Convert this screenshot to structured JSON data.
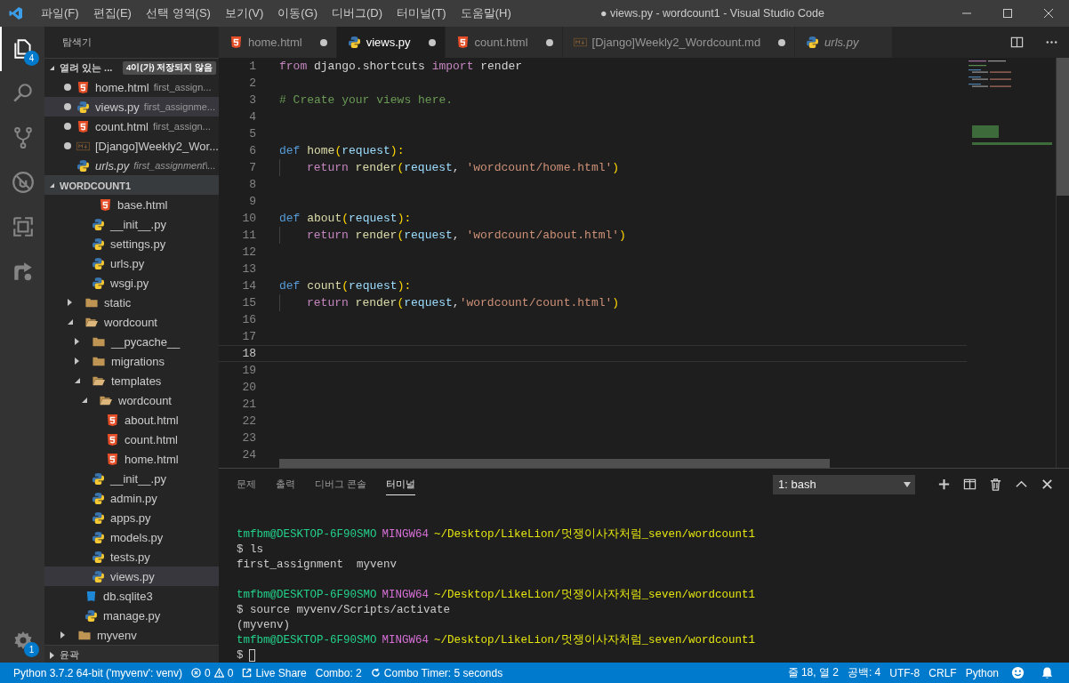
{
  "window": {
    "title": "● views.py - wordcount1 - Visual Studio Code"
  },
  "menu": [
    "파일(F)",
    "편집(E)",
    "선택 영역(S)",
    "보기(V)",
    "이동(G)",
    "디버그(D)",
    "터미널(T)",
    "도움말(H)"
  ],
  "activity_bar": [
    {
      "kind": "files",
      "selected": true,
      "badge": "4"
    },
    {
      "kind": "search",
      "selected": false
    },
    {
      "kind": "git",
      "selected": false
    },
    {
      "kind": "debug",
      "selected": false
    },
    {
      "kind": "extensions",
      "selected": false
    },
    {
      "kind": "liveshare",
      "selected": false
    }
  ],
  "manage": {
    "badge": "1"
  },
  "explorer": {
    "title": "탐색기",
    "open_editors": {
      "title": "열려 있는 ...",
      "expanded": true,
      "badge": "4이(가) 저장되지 않음",
      "items": [
        {
          "name": "home.html",
          "path": "first_assign...",
          "kind": "html",
          "dirty": true,
          "selected": false,
          "preview": false
        },
        {
          "name": "views.py",
          "path": "first_assignme...",
          "kind": "python",
          "dirty": true,
          "selected": true,
          "preview": false
        },
        {
          "name": "count.html",
          "path": "first_assign...",
          "kind": "html",
          "dirty": true,
          "selected": false,
          "preview": false
        },
        {
          "name": "[Django]Weekly2_Wor...",
          "kind": "markdown",
          "dirty": true,
          "selected": false,
          "preview": false
        },
        {
          "name": "urls.py",
          "path": "first_assignment\\...",
          "kind": "python",
          "dirty": false,
          "selected": false,
          "preview": true
        }
      ]
    },
    "folder": {
      "title": "WORDCOUNT1",
      "expanded": true
    },
    "tree": [
      {
        "children": [
          {
            "children": [
              {
                "children": [
                  {
                    "name": "base.html",
                    "kind": "html",
                    "selected": false
                  }
                ]
              },
              {
                "name": "__init__.py",
                "kind": "python",
                "selected": false
              },
              {
                "name": "settings.py",
                "kind": "python",
                "selected": false
              },
              {
                "name": "urls.py",
                "kind": "python",
                "selected": false
              },
              {
                "name": "wsgi.py",
                "kind": "python",
                "selected": false
              }
            ]
          },
          {
            "name": "static",
            "kind": "folder",
            "expanded": false,
            "selected": false
          },
          {
            "name": "wordcount",
            "kind": "folder",
            "expanded": true,
            "selected": false,
            "children": [
              {
                "name": "__pycache__",
                "kind": "folder",
                "expanded": false,
                "selected": false
              },
              {
                "name": "migrations",
                "kind": "folder",
                "expanded": false,
                "selected": false
              },
              {
                "name": "templates",
                "kind": "folder",
                "expanded": true,
                "selected": false,
                "children": [
                  {
                    "name": "wordcount",
                    "kind": "folder",
                    "expanded": true,
                    "selected": false,
                    "children": [
                      {
                        "name": "about.html",
                        "kind": "html",
                        "selected": false
                      },
                      {
                        "name": "count.html",
                        "kind": "html",
                        "selected": false
                      },
                      {
                        "name": "home.html",
                        "kind": "html",
                        "selected": false
                      }
                    ]
                  }
                ]
              },
              {
                "name": "__init__.py",
                "kind": "python",
                "selected": false
              },
              {
                "name": "admin.py",
                "kind": "python",
                "selected": false
              },
              {
                "name": "apps.py",
                "kind": "python",
                "selected": false
              },
              {
                "name": "models.py",
                "kind": "python",
                "selected": false
              },
              {
                "name": "tests.py",
                "kind": "python",
                "selected": false
              },
              {
                "name": "views.py",
                "kind": "python",
                "selected": true
              }
            ]
          },
          {
            "name": "db.sqlite3",
            "kind": "sqlite",
            "selected": false
          },
          {
            "name": "manage.py",
            "kind": "python",
            "selected": false
          }
        ]
      },
      {
        "name": "myvenv",
        "kind": "folder",
        "expanded": false,
        "selected": false
      }
    ],
    "outline": {
      "title": "윤곽",
      "expanded": false
    }
  },
  "tabs": [
    {
      "name": "home.html",
      "kind": "html",
      "dirty": true,
      "selected": false,
      "preview": false
    },
    {
      "name": "views.py",
      "kind": "python",
      "dirty": true,
      "selected": true,
      "preview": false
    },
    {
      "name": "count.html",
      "kind": "html",
      "dirty": true,
      "selected": false,
      "preview": false
    },
    {
      "name": "[Django]Weekly2_Wordcount.md",
      "kind": "markdown",
      "dirty": true,
      "selected": false,
      "preview": false
    },
    {
      "name": "urls.py",
      "kind": "python",
      "dirty": false,
      "selected": false,
      "preview": true
    }
  ],
  "code": [
    {
      "number": "1",
      "current": false,
      "indent": false,
      "tokens": [
        {
          "text": "from",
          "kind": "kw"
        },
        {
          "text": " django.shortcuts ",
          "kind": "plain"
        },
        {
          "text": "import",
          "kind": "kw"
        },
        {
          "text": " render",
          "kind": "plain"
        }
      ]
    },
    {
      "number": "2",
      "current": false,
      "indent": false
    },
    {
      "number": "3",
      "current": false,
      "indent": false,
      "tokens": [
        {
          "text": "# Create your views here.",
          "kind": "comment"
        }
      ]
    },
    {
      "number": "4",
      "current": false,
      "indent": false
    },
    {
      "number": "5",
      "current": false,
      "indent": false
    },
    {
      "number": "6",
      "current": false,
      "indent": false,
      "tokens": [
        {
          "text": "def ",
          "kind": "def"
        },
        {
          "text": "home",
          "kind": "fn"
        },
        {
          "text": "(",
          "kind": "paren"
        },
        {
          "text": "request",
          "kind": "param"
        },
        {
          "text": "):",
          "kind": "paren"
        }
      ]
    },
    {
      "number": "7",
      "current": false,
      "indent": true,
      "tokens": [
        {
          "text": "return ",
          "kind": "kw"
        },
        {
          "text": "render",
          "kind": "fn"
        },
        {
          "text": "(",
          "kind": "paren"
        },
        {
          "text": "request",
          "kind": "param"
        },
        {
          "text": ", ",
          "kind": "plain"
        },
        {
          "text": "'wordcount/home.html'",
          "kind": "str"
        },
        {
          "text": ")",
          "kind": "paren"
        }
      ]
    },
    {
      "number": "8",
      "current": false,
      "indent": false
    },
    {
      "number": "9",
      "current": false,
      "indent": false
    },
    {
      "number": "10",
      "current": false,
      "indent": false,
      "tokens": [
        {
          "text": "def ",
          "kind": "def"
        },
        {
          "text": "about",
          "kind": "fn"
        },
        {
          "text": "(",
          "kind": "paren"
        },
        {
          "text": "request",
          "kind": "param"
        },
        {
          "text": "):",
          "kind": "paren"
        }
      ]
    },
    {
      "number": "11",
      "current": false,
      "indent": true,
      "tokens": [
        {
          "text": "return ",
          "kind": "kw"
        },
        {
          "text": "render",
          "kind": "fn"
        },
        {
          "text": "(",
          "kind": "paren"
        },
        {
          "text": "request",
          "kind": "param"
        },
        {
          "text": ", ",
          "kind": "plain"
        },
        {
          "text": "'wordcount/about.html'",
          "kind": "str"
        },
        {
          "text": ")",
          "kind": "paren"
        }
      ]
    },
    {
      "number": "12",
      "current": false,
      "indent": false
    },
    {
      "number": "13",
      "current": false,
      "indent": false
    },
    {
      "number": "14",
      "current": false,
      "indent": false,
      "tokens": [
        {
          "text": "def ",
          "kind": "def"
        },
        {
          "text": "count",
          "kind": "fn"
        },
        {
          "text": "(",
          "kind": "paren"
        },
        {
          "text": "request",
          "kind": "param"
        },
        {
          "text": "):",
          "kind": "paren"
        }
      ]
    },
    {
      "number": "15",
      "current": false,
      "indent": true,
      "tokens": [
        {
          "text": "return ",
          "kind": "kw"
        },
        {
          "text": "render",
          "kind": "fn"
        },
        {
          "text": "(",
          "kind": "paren"
        },
        {
          "text": "request",
          "kind": "param"
        },
        {
          "text": ",",
          "kind": "plain"
        },
        {
          "text": "'wordcount/count.html'",
          "kind": "str"
        },
        {
          "text": ")",
          "kind": "paren"
        }
      ]
    },
    {
      "number": "16",
      "current": false,
      "indent": false
    },
    {
      "number": "17",
      "current": false,
      "indent": false
    },
    {
      "number": "18",
      "current": true,
      "indent": false
    },
    {
      "number": "19",
      "current": false,
      "indent": false
    },
    {
      "number": "20",
      "current": false,
      "indent": false
    },
    {
      "number": "21",
      "current": false,
      "indent": false
    },
    {
      "number": "22",
      "current": false,
      "indent": false
    },
    {
      "number": "23",
      "current": false,
      "indent": false
    },
    {
      "number": "24",
      "current": false,
      "indent": false
    }
  ],
  "panel": {
    "tabs": [
      {
        "label": "문제",
        "selected": false
      },
      {
        "label": "출력",
        "selected": false
      },
      {
        "label": "디버그 콘솔",
        "selected": false
      },
      {
        "label": "터미널",
        "selected": true
      }
    ],
    "terminal_select": "1: bash",
    "terminal": [
      {
        "kind": "prompt",
        "user": "tmfbm@DESKTOP-6F90SMO",
        "system": "MINGW64",
        "path": "~/Desktop/LikeLion/멋쟁이사자처럼_seven/wordcount1"
      },
      {
        "kind": "text",
        "text": "$ ls"
      },
      {
        "kind": "text",
        "text": "first_assignment  myvenv"
      },
      {
        "kind": "blank"
      },
      {
        "kind": "prompt",
        "user": "tmfbm@DESKTOP-6F90SMO",
        "system": "MINGW64",
        "path": "~/Desktop/LikeLion/멋쟁이사자처럼_seven/wordcount1"
      },
      {
        "kind": "text",
        "text": "$ source myvenv/Scripts/activate"
      },
      {
        "kind": "text",
        "text": "(myvenv)"
      },
      {
        "kind": "prompt",
        "user": "tmfbm@DESKTOP-6F90SMO",
        "system": "MINGW64",
        "path": "~/Desktop/LikeLion/멋쟁이사자처럼_seven/wordcount1"
      },
      {
        "kind": "input",
        "text": "$"
      }
    ]
  },
  "status_bar": {
    "left": [
      {
        "kind": "text",
        "text": "Python 3.7.2 64-bit ('myvenv': venv)"
      },
      {
        "kind": "problems",
        "errors": "0",
        "warnings": "0"
      },
      {
        "kind": "liveshare",
        "text": "Live Share"
      },
      {
        "kind": "text",
        "text": "Combo: 2"
      },
      {
        "kind": "timer",
        "text": "Combo Timer: 5 seconds"
      }
    ],
    "right": [
      {
        "kind": "text",
        "text": "줄 18, 열 2"
      },
      {
        "kind": "text",
        "text": "공백: 4"
      },
      {
        "kind": "text",
        "text": "UTF-8"
      },
      {
        "kind": "text",
        "text": "CRLF"
      },
      {
        "kind": "text",
        "text": "Python"
      },
      {
        "kind": "smiley"
      },
      {
        "kind": "bell"
      }
    ]
  }
}
